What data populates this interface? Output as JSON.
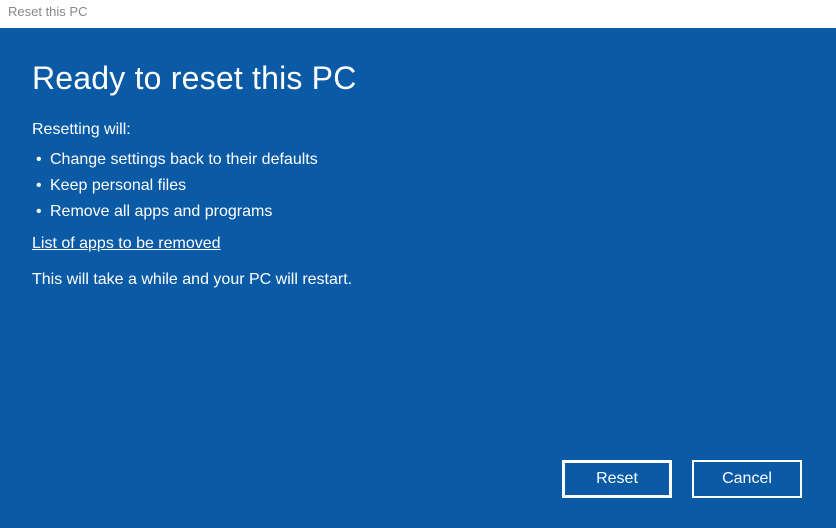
{
  "titlebar": {
    "title": "Reset this PC"
  },
  "main": {
    "heading": "Ready to reset this PC",
    "subheading": "Resetting will:",
    "bullets": [
      "Change settings back to their defaults",
      "Keep personal files",
      "Remove all apps and programs"
    ],
    "link_text": "List of apps to be removed",
    "note": "This will take a while and your PC will restart."
  },
  "buttons": {
    "reset": "Reset",
    "cancel": "Cancel"
  }
}
